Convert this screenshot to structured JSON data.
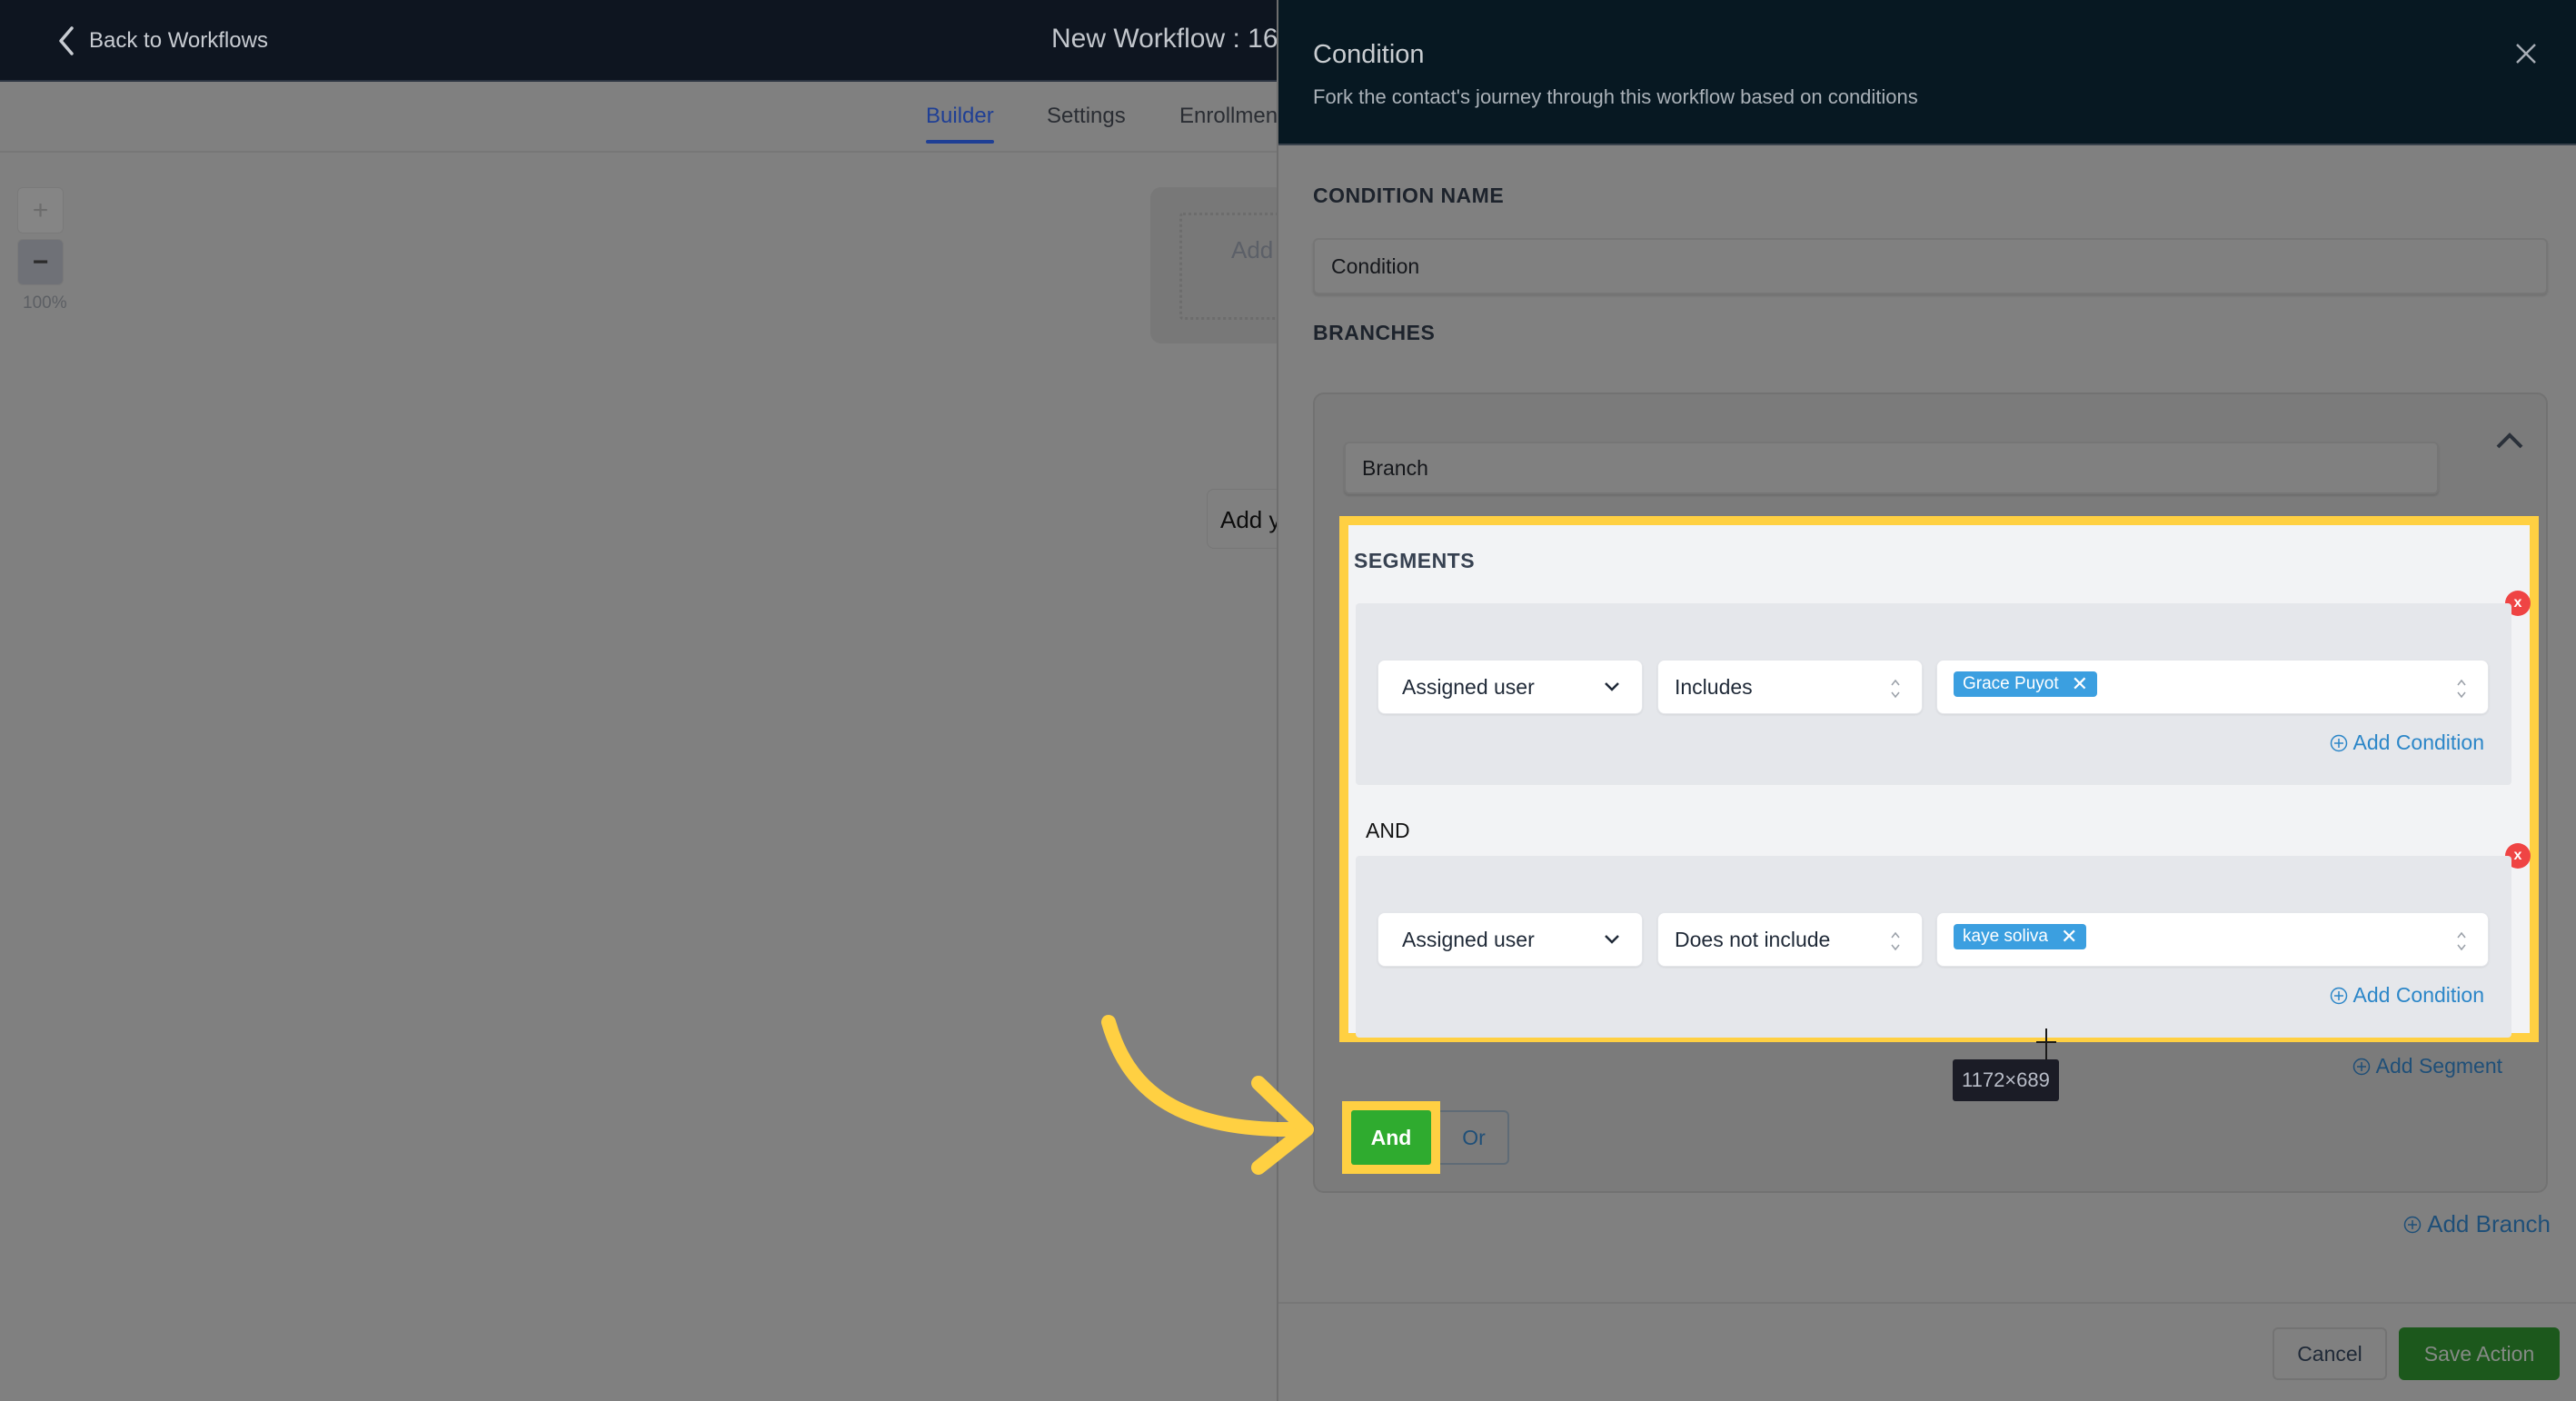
{
  "app": {
    "back_label": "Back to Workflows",
    "workflow_title": "New Workflow : 16",
    "tabs": [
      {
        "label": "Builder",
        "active": true
      },
      {
        "label": "Settings",
        "active": false
      },
      {
        "label": "Enrollmen",
        "active": false
      }
    ],
    "canvas": {
      "zoom_in_icon": "+",
      "zoom_out_icon": "−",
      "zoom_level": "100%",
      "trigger_placeholder": "Add",
      "add_step_text": "Add y"
    }
  },
  "panel": {
    "title": "Condition",
    "subtitle": "Fork the contact's journey through this workflow based on conditions",
    "close_icon": "close-icon",
    "condition_name_label": "CONDITION NAME",
    "condition_name_value": "Condition",
    "branches_label": "BRANCHES",
    "branch": {
      "name_value": "Branch",
      "segments_label": "SEGMENTS",
      "segments": [
        {
          "field": "Assigned user",
          "operator": "Includes",
          "values": [
            "Grace Puyot"
          ],
          "add_condition_label": "Add Condition"
        },
        {
          "connector": "AND",
          "field": "Assigned user",
          "operator": "Does not include",
          "values": [
            "kaye soliva"
          ],
          "add_condition_label": "Add Condition"
        }
      ],
      "remove_icon": "x",
      "add_segment_label": "Add Segment",
      "logic_options": [
        {
          "label": "And",
          "selected": true
        },
        {
          "label": "Or",
          "selected": false
        }
      ]
    },
    "add_branch_label": "Add Branch",
    "cancel_label": "Cancel",
    "save_label": "Save Action"
  },
  "overlay": {
    "dimension_tooltip": "1172×689",
    "highlight_color": "#ffd042"
  },
  "colors": {
    "accent_blue": "#2b86c8",
    "and_green": "#2fab2f",
    "save_green": "#1c581c",
    "remove_red": "#ef4444",
    "tag_blue": "#3b9fe0"
  }
}
